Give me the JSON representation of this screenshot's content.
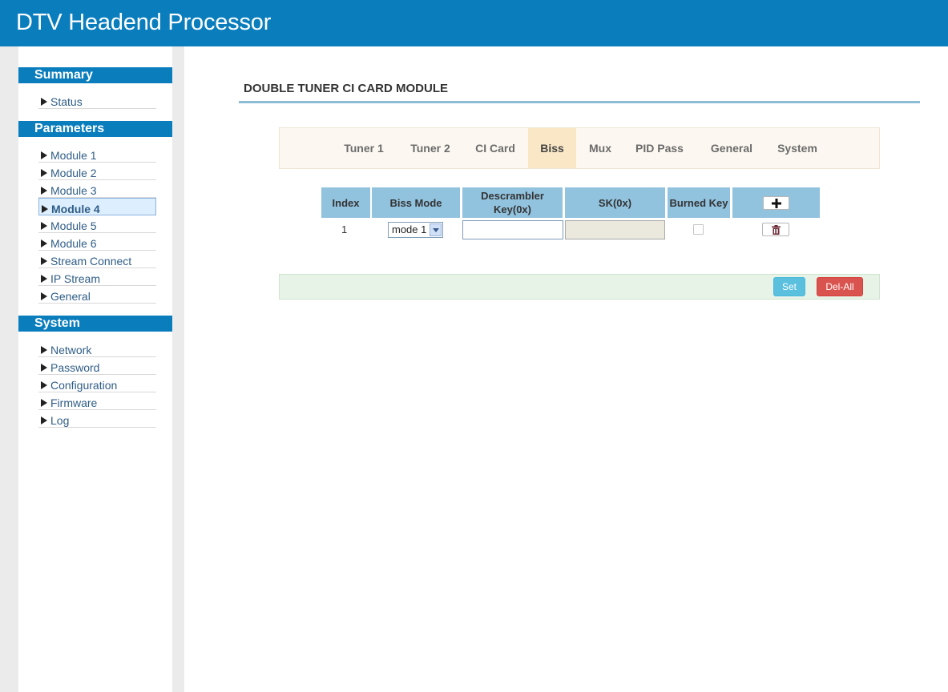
{
  "app": {
    "title": "DTV Headend Processor"
  },
  "sidebar": {
    "sections": [
      {
        "heading": "Summary",
        "items": [
          {
            "label": "Status"
          }
        ]
      },
      {
        "heading": "Parameters",
        "items": [
          {
            "label": "Module 1"
          },
          {
            "label": "Module 2"
          },
          {
            "label": "Module 3"
          },
          {
            "label": "Module 4",
            "active": true
          },
          {
            "label": "Module 5"
          },
          {
            "label": "Module 6"
          },
          {
            "label": "Stream Connect"
          },
          {
            "label": "IP Stream"
          },
          {
            "label": "General"
          }
        ]
      },
      {
        "heading": "System",
        "items": [
          {
            "label": "Network"
          },
          {
            "label": "Password"
          },
          {
            "label": "Configuration"
          },
          {
            "label": "Firmware"
          },
          {
            "label": "Log"
          }
        ]
      }
    ]
  },
  "page": {
    "title": "DOUBLE TUNER CI CARD MODULE",
    "tabs": [
      {
        "label": "Tuner 1"
      },
      {
        "label": "Tuner 2"
      },
      {
        "label": "CI Card"
      },
      {
        "label": "Biss",
        "active": true
      },
      {
        "label": "Mux"
      },
      {
        "label": "PID Pass"
      },
      {
        "label": "General"
      },
      {
        "label": "System"
      }
    ],
    "table": {
      "columns": [
        "Index",
        "Biss Mode",
        "Descrambler Key(0x)",
        "SK(0x)",
        "Burned Key"
      ],
      "rows": [
        {
          "index": "1",
          "biss_mode": "mode 1",
          "descrambler_key": "",
          "sk": "",
          "burned_key": false
        }
      ]
    },
    "actions": {
      "set_label": "Set",
      "delall_label": "Del-All"
    }
  },
  "colors": {
    "header": "#0a7dbd",
    "table_head": "#91c2de",
    "tab_active": "#f9e7c6",
    "set_button": "#5bc0de",
    "delall_button": "#d9534f"
  }
}
